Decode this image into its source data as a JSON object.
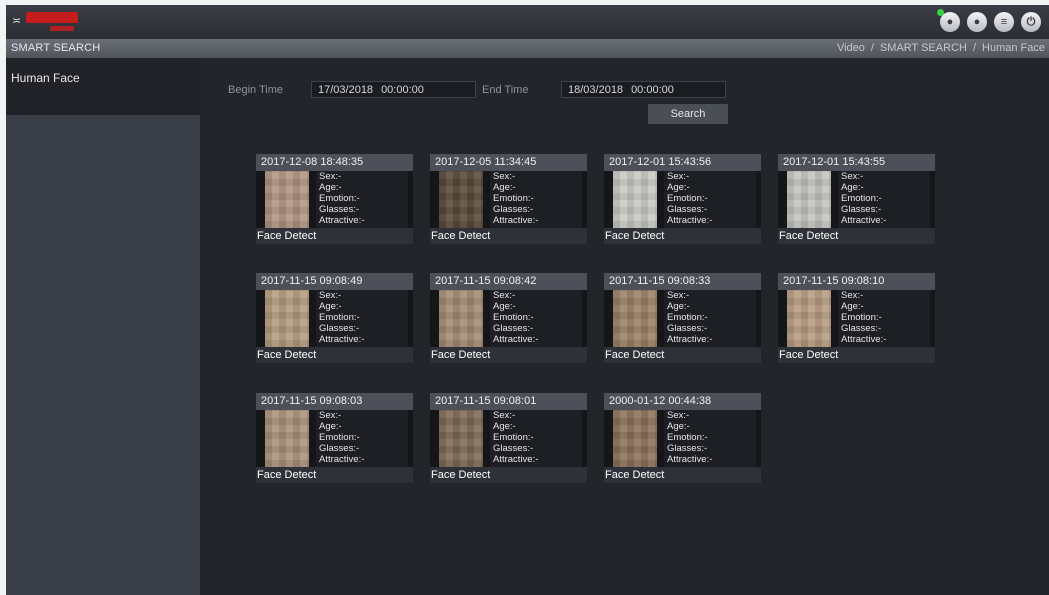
{
  "header": {
    "logo": "logo",
    "title": "SMART SEARCH",
    "breadcrumb": [
      "Video",
      "SMART SEARCH",
      "Human Face"
    ],
    "icons": [
      "live-view-icon",
      "user-icon",
      "menu-icon",
      "power-icon"
    ]
  },
  "sidebar": {
    "items": [
      {
        "label": "Human Face"
      }
    ]
  },
  "search": {
    "begin_label": "Begin Time",
    "begin_date": "17/03/2018",
    "begin_time": "00:00:00",
    "end_label": "End Time",
    "end_date": "18/03/2018",
    "end_time": "00:00:00",
    "button": "Search"
  },
  "attr_labels": {
    "sex": "Sex:-",
    "age": "Age:-",
    "emotion": "Emotion:-",
    "glasses": "Glasses:-",
    "attractive": "Attractive:-"
  },
  "results": [
    {
      "timestamp": "2017-12-08 18:48:35",
      "label": "Face Detect"
    },
    {
      "timestamp": "2017-12-05 11:34:45",
      "label": "Face Detect"
    },
    {
      "timestamp": "2017-12-01 15:43:56",
      "label": "Face Detect"
    },
    {
      "timestamp": "2017-12-01 15:43:55",
      "label": "Face Detect"
    },
    {
      "timestamp": "2017-11-15 09:08:49",
      "label": "Face Detect"
    },
    {
      "timestamp": "2017-11-15 09:08:42",
      "label": "Face Detect"
    },
    {
      "timestamp": "2017-11-15 09:08:33",
      "label": "Face Detect"
    },
    {
      "timestamp": "2017-11-15 09:08:10",
      "label": "Face Detect"
    },
    {
      "timestamp": "2017-11-15 09:08:03",
      "label": "Face Detect"
    },
    {
      "timestamp": "2017-11-15 09:08:01",
      "label": "Face Detect"
    },
    {
      "timestamp": "2000-01-12 00:44:38",
      "label": "Face Detect"
    }
  ]
}
